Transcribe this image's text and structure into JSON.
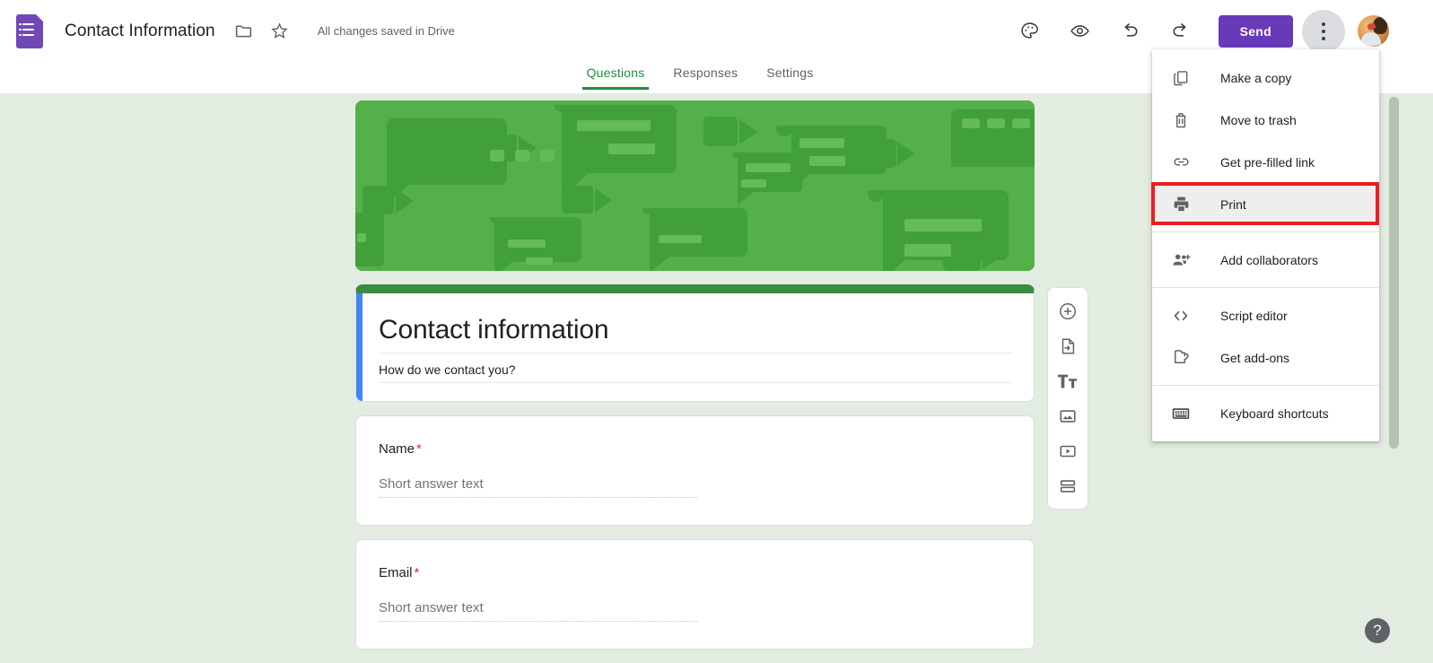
{
  "app": {
    "logo_icon": "google-forms-logo-icon",
    "doc_title": "Contact Information",
    "save_status": "All changes saved in Drive"
  },
  "title_actions": [
    {
      "name": "move-to-folder-icon",
      "label": "Move to folder"
    },
    {
      "name": "star-icon",
      "label": "Star"
    }
  ],
  "toolbar": {
    "theme_label": "Customize theme",
    "preview_label": "Preview",
    "undo_label": "Undo",
    "redo_label": "Redo",
    "send_label": "Send",
    "more_label": "More options",
    "avatar_label": "Account"
  },
  "tabs": [
    {
      "label": "Questions",
      "active": true
    },
    {
      "label": "Responses",
      "active": false
    },
    {
      "label": "Settings",
      "active": false
    }
  ],
  "form": {
    "banner_alt": "Communication themed green banner",
    "title": "Contact information",
    "description": "How do we contact you?",
    "questions": [
      {
        "label": "Name",
        "required_marker": "*",
        "answer_placeholder": "Short answer text"
      },
      {
        "label": "Email",
        "required_marker": "*",
        "answer_placeholder": "Short answer text"
      }
    ]
  },
  "side_toolbar": [
    {
      "name": "add-question-icon",
      "label": "Add question"
    },
    {
      "name": "import-questions-icon",
      "label": "Import questions"
    },
    {
      "name": "add-title-description-icon",
      "label": "Add title and description"
    },
    {
      "name": "add-image-icon",
      "label": "Add image"
    },
    {
      "name": "add-video-icon",
      "label": "Add video"
    },
    {
      "name": "add-section-icon",
      "label": "Add section"
    }
  ],
  "menu": {
    "items": [
      {
        "label": "Make a copy",
        "icon": "copy-icon",
        "highlight": false,
        "sep_after": false
      },
      {
        "label": "Move to trash",
        "icon": "trash-icon",
        "highlight": false,
        "sep_after": false
      },
      {
        "label": "Get pre-filled link",
        "icon": "link-icon",
        "highlight": false,
        "sep_after": false
      },
      {
        "label": "Print",
        "icon": "print-icon",
        "highlight": true,
        "sep_after": true
      },
      {
        "label": "Add collaborators",
        "icon": "add-collaborators-icon",
        "highlight": false,
        "sep_after": true
      },
      {
        "label": "Script editor",
        "icon": "code-brackets-icon",
        "highlight": false,
        "sep_after": false
      },
      {
        "label": "Get add-ons",
        "icon": "puzzle-piece-icon",
        "highlight": false,
        "sep_after": true
      },
      {
        "label": "Keyboard shortcuts",
        "icon": "keyboard-icon",
        "highlight": false,
        "sep_after": false
      }
    ]
  },
  "help": {
    "label": "?"
  },
  "colors": {
    "brand_purple": "#673ab7",
    "accent_green": "#1e8e3e",
    "banner_green": "#53b04a",
    "header_bar_green": "#3c8c40",
    "card_blue_accent": "#4285f4",
    "required_red": "#d93025",
    "highlight_red": "#ed1c24",
    "page_background": "#e3ece1"
  }
}
